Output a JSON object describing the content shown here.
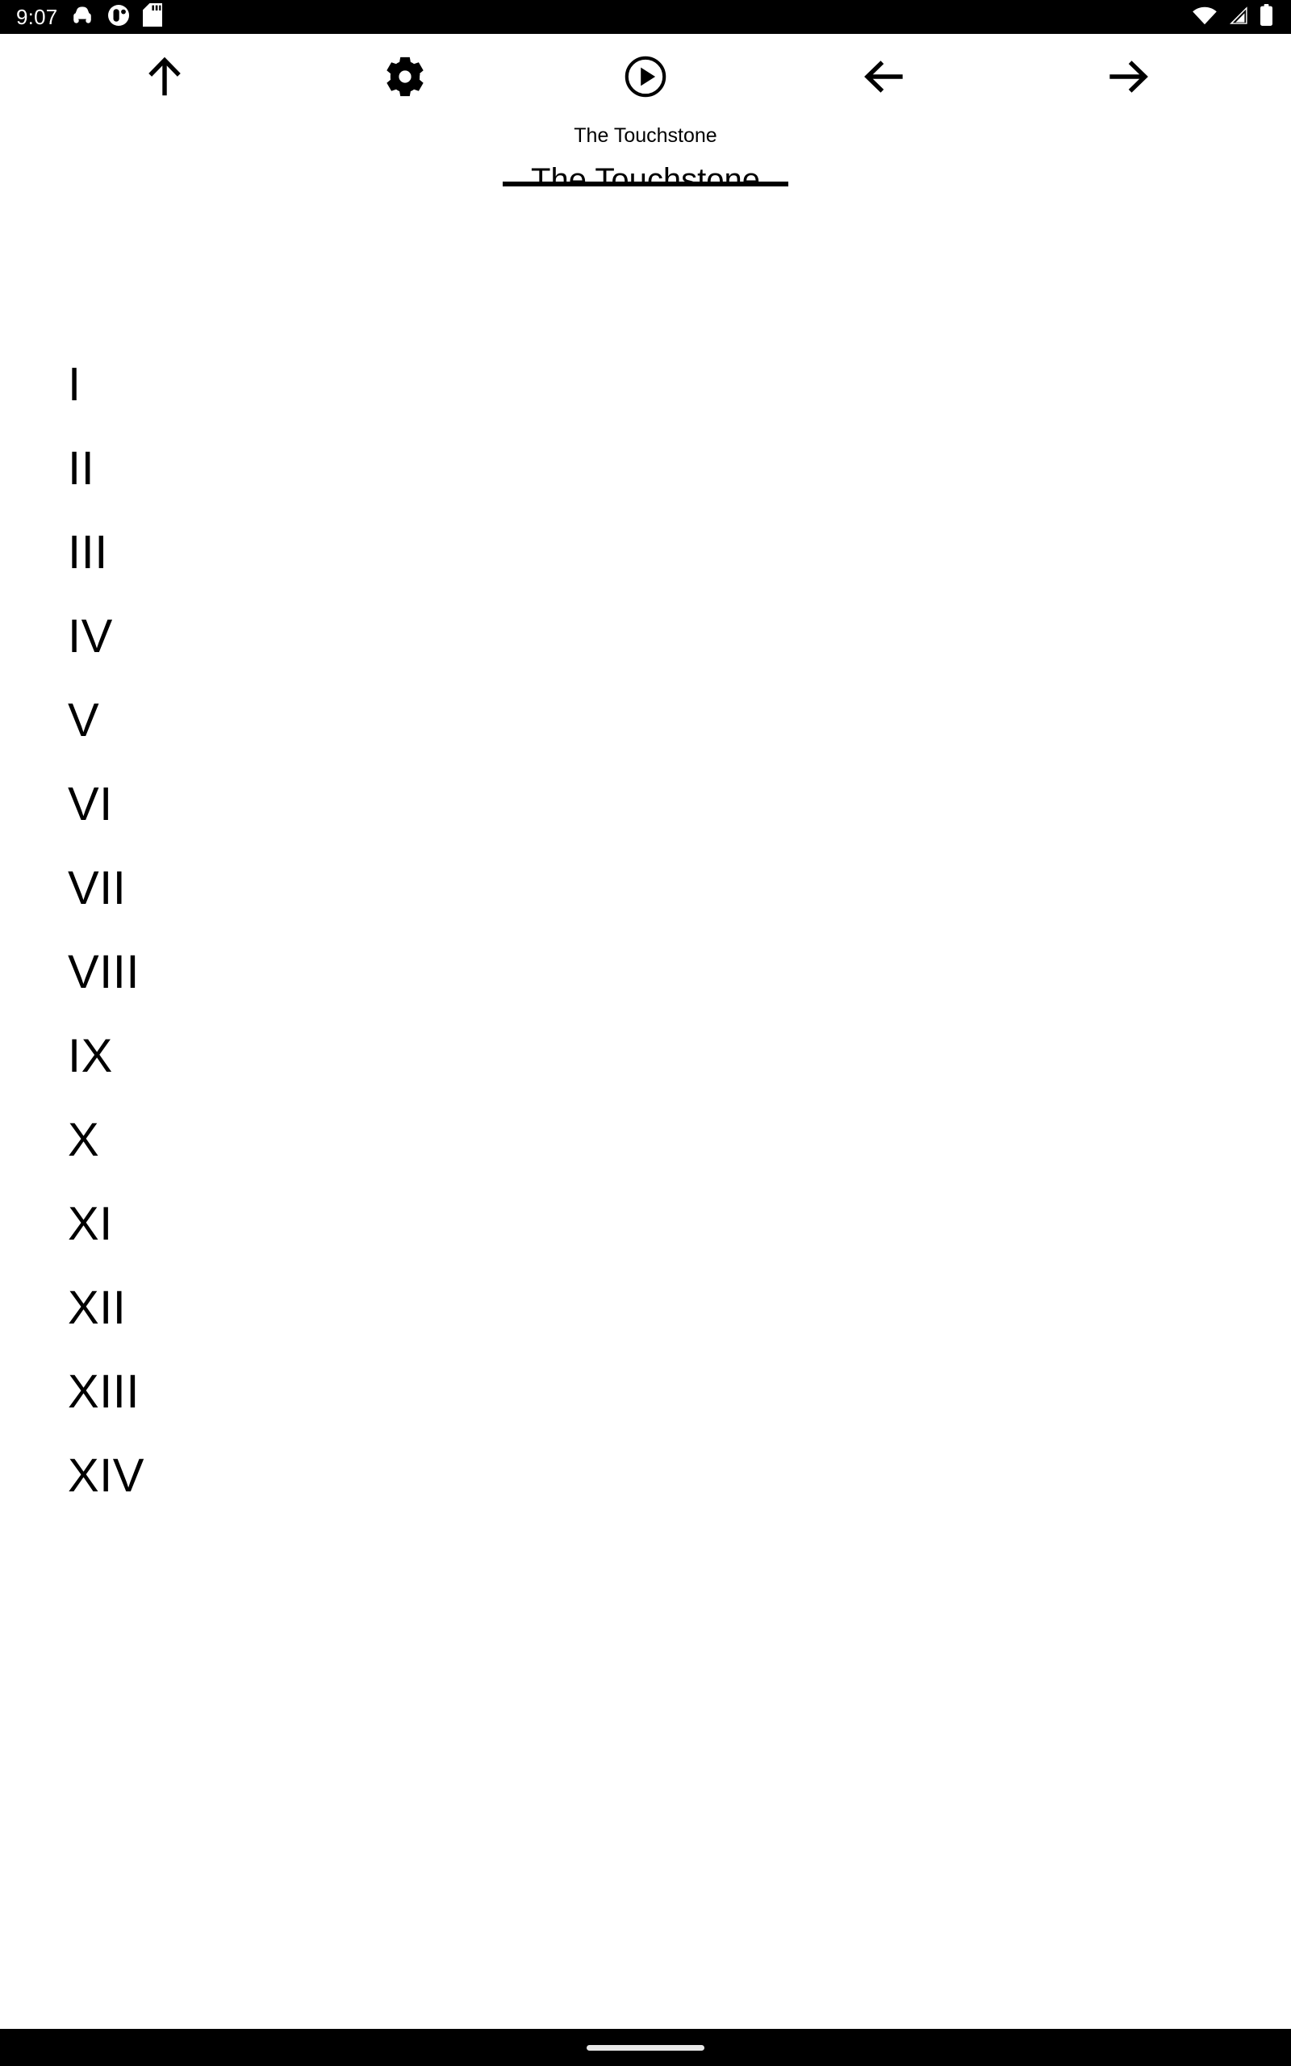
{
  "theme": {
    "background": "#ffffff",
    "foreground": "#000000",
    "status_bar_bg": "#000000",
    "status_bar_fg": "#ffffff",
    "nav_bar_bg": "#000000",
    "nav_handle": "#e8e8e8"
  },
  "status_bar": {
    "clock": "9:07",
    "left_icons": [
      {
        "name": "android-auto-car-icon",
        "label": "Android Auto"
      },
      {
        "name": "do-not-disturb-circle-icon",
        "label": "Notification"
      },
      {
        "name": "sd-card-icon",
        "label": "SD card"
      }
    ],
    "right_icons": [
      {
        "name": "wifi-icon",
        "label": "Wi-Fi"
      },
      {
        "name": "cellular-signal-icon",
        "label": "Mobile signal"
      },
      {
        "name": "battery-icon",
        "label": "Battery"
      }
    ]
  },
  "toolbar": {
    "buttons": [
      {
        "name": "scroll-to-top-button",
        "icon": "arrow-up-icon",
        "label": "Up"
      },
      {
        "name": "settings-button",
        "icon": "gear-icon",
        "label": "Settings"
      },
      {
        "name": "play-button",
        "icon": "play-circle-icon",
        "label": "Play"
      },
      {
        "name": "previous-button",
        "icon": "arrow-left-icon",
        "label": "Previous"
      },
      {
        "name": "next-button",
        "icon": "arrow-right-icon",
        "label": "Next"
      }
    ]
  },
  "title_block": {
    "subtitle": "The Touchstone",
    "title_value": "The Touchstone",
    "title_placeholder": "The Touchstone"
  },
  "content": {
    "chapters": [
      {
        "label": "I"
      },
      {
        "label": "II"
      },
      {
        "label": "III"
      },
      {
        "label": "IV"
      },
      {
        "label": "V"
      },
      {
        "label": "VI"
      },
      {
        "label": "VII"
      },
      {
        "label": "VIII"
      },
      {
        "label": "IX"
      },
      {
        "label": "X"
      },
      {
        "label": "XI"
      },
      {
        "label": "XII"
      },
      {
        "label": "XIII"
      },
      {
        "label": "XIV"
      }
    ]
  },
  "nav_bar": {
    "handle_name": "gesture-home-handle"
  }
}
